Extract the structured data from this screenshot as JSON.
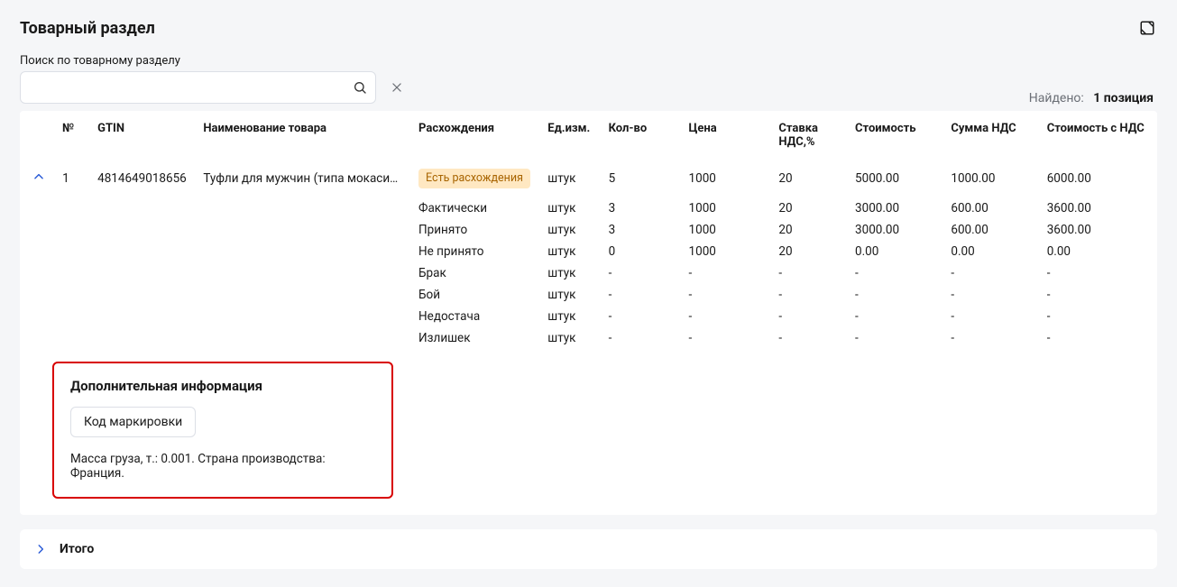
{
  "section_title": "Товарный раздел",
  "search_label": "Поиск по товарному разделу",
  "search_value": "",
  "found_label": "Найдено:",
  "found_count": "1 позиция",
  "columns": {
    "no": "№",
    "gtin": "GTIN",
    "name": "Наименование товара",
    "disc": "Расхождения",
    "unit": "Ед.изм.",
    "qty": "Кол-во",
    "price": "Цена",
    "vat": "Ставка НДС,%",
    "cost": "Стоимость",
    "vatsum": "Сумма НДС",
    "total": "Стоимость с НДС"
  },
  "main_row": {
    "no": "1",
    "gtin": "4814649018656",
    "name": "Туфли для мужчин (типа мокасин) …",
    "disc_badge": "Есть расхождения",
    "unit": "штук",
    "qty": "5",
    "price": "1000",
    "vat": "20",
    "cost": "5000.00",
    "vatsum": "1000.00",
    "total": "6000.00"
  },
  "subrows": [
    {
      "label": "Фактически",
      "unit": "штук",
      "qty": "3",
      "price": "1000",
      "vat": "20",
      "cost": "3000.00",
      "vatsum": "600.00",
      "total": "3600.00"
    },
    {
      "label": "Принято",
      "unit": "штук",
      "qty": "3",
      "price": "1000",
      "vat": "20",
      "cost": "3000.00",
      "vatsum": "600.00",
      "total": "3600.00"
    },
    {
      "label": "Не принято",
      "unit": "штук",
      "qty": "0",
      "price": "1000",
      "vat": "20",
      "cost": "0.00",
      "vatsum": "0.00",
      "total": "0.00"
    },
    {
      "label": "Брак",
      "unit": "штук",
      "qty": "-",
      "price": "-",
      "vat": "-",
      "cost": "-",
      "vatsum": "-",
      "total": "-"
    },
    {
      "label": "Бой",
      "unit": "штук",
      "qty": "-",
      "price": "-",
      "vat": "-",
      "cost": "-",
      "vatsum": "-",
      "total": "-"
    },
    {
      "label": "Недостача",
      "unit": "штук",
      "qty": "-",
      "price": "-",
      "vat": "-",
      "cost": "-",
      "vatsum": "-",
      "total": "-"
    },
    {
      "label": "Излишек",
      "unit": "штук",
      "qty": "-",
      "price": "-",
      "vat": "-",
      "cost": "-",
      "vatsum": "-",
      "total": "-"
    }
  ],
  "extra": {
    "title": "Дополнительная информация",
    "button": "Код маркировки",
    "text": "Масса груза, т.: 0.001. Страна производства: Франция."
  },
  "total_panel": "Итого"
}
